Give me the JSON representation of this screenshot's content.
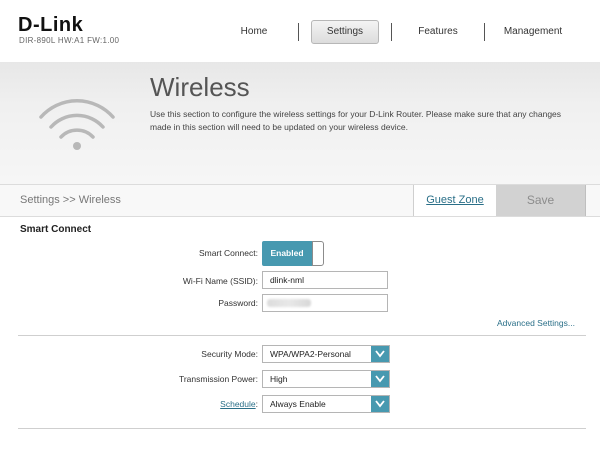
{
  "brand": {
    "logo": "D-Link",
    "model": "DIR-890L   HW:A1   FW:1.00"
  },
  "nav": {
    "home": "Home",
    "settings": "Settings",
    "features": "Features",
    "management": "Management"
  },
  "hero": {
    "title": "Wireless",
    "description": "Use this section to configure the wireless settings for your D-Link Router. Please make sure that any changes made in this section will need to be updated on your wireless device."
  },
  "breadcrumb": "Settings >> Wireless",
  "actions": {
    "guest_zone": "Guest Zone",
    "save": "Save"
  },
  "smart_connect": {
    "section_title": "Smart Connect",
    "toggle_label": "Smart Connect:",
    "toggle_value": "Enabled",
    "ssid_label": "Wi-Fi Name (SSID):",
    "ssid_value": "dlink-nml",
    "password_label": "Password:",
    "password_value": ""
  },
  "advanced_link": "Advanced Settings...",
  "security": {
    "mode_label": "Security Mode:",
    "mode_value": "WPA/WPA2-Personal",
    "power_label": "Transmission Power:",
    "power_value": "High",
    "schedule_label": "Schedule",
    "schedule_colon": ":",
    "schedule_value": "Always Enable"
  },
  "colors": {
    "accent": "#4799b0",
    "link": "#2a6f88"
  }
}
